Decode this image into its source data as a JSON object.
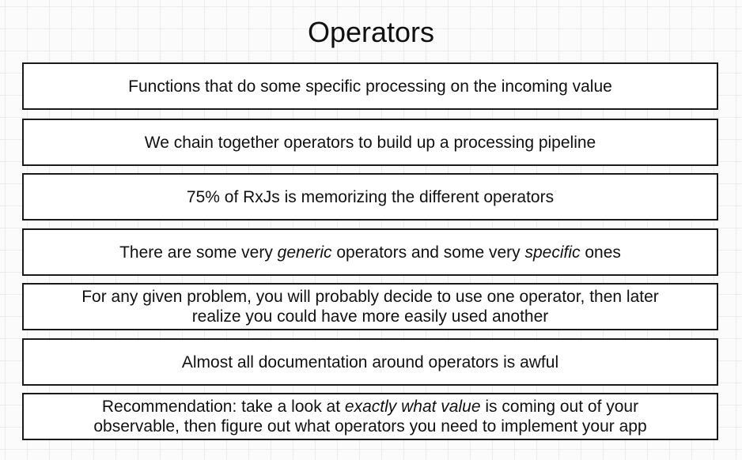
{
  "title": "Operators",
  "boxes": [
    {
      "text": "Functions that do some specific processing on the incoming value"
    },
    {
      "text": "We chain together operators to build up a processing pipeline"
    },
    {
      "text": "75% of RxJs is memorizing the different operators"
    },
    {
      "part1": "There are some very ",
      "em1": "generic",
      "part2": " operators and some very ",
      "em2": "specific",
      "part3": " ones"
    },
    {
      "line1": "For any given problem, you will probably decide to use one operator, then later",
      "line2": "realize you could have more easily used another"
    },
    {
      "text": "Almost all documentation around operators is awful"
    },
    {
      "part1": "Recommendation: take a look at ",
      "em1": "exactly what value",
      "part2": " is coming out of your",
      "line2": "observable, then figure out what operators you need to implement your app"
    }
  ]
}
